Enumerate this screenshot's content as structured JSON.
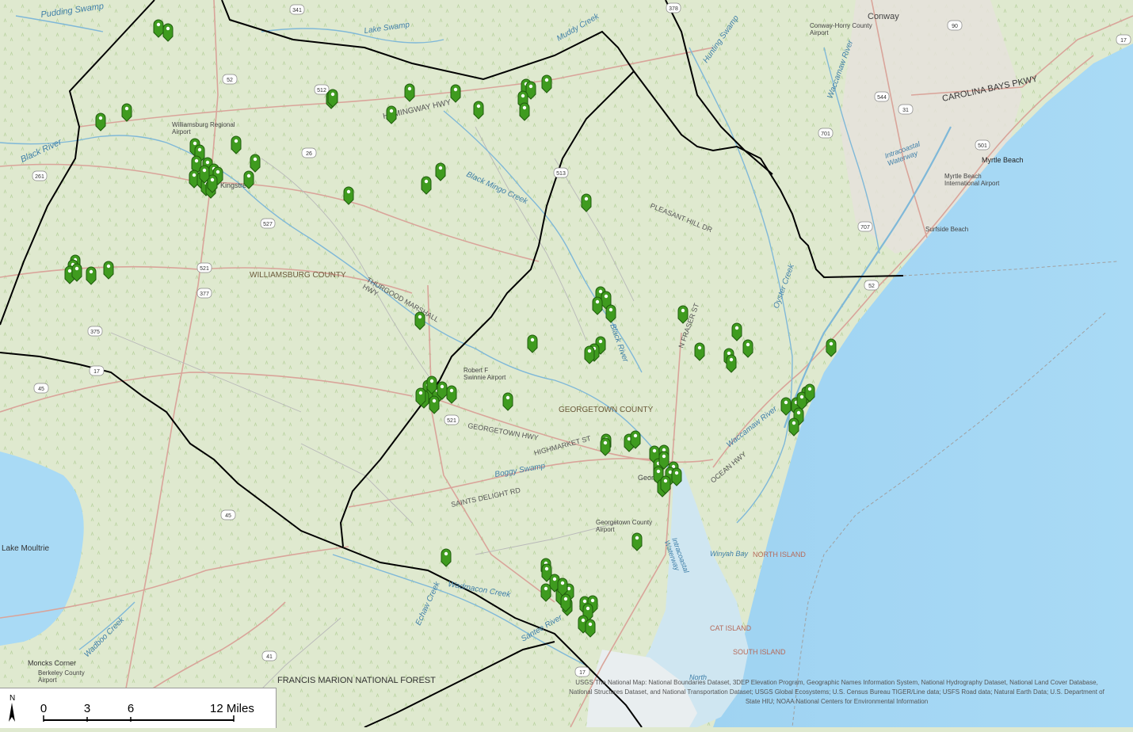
{
  "map": {
    "place_labels": [
      {
        "id": "pudding-swamp",
        "text": "Pudding Swamp"
      },
      {
        "id": "lake-swamp",
        "text": "Lake Swamp"
      },
      {
        "id": "muddy-creek",
        "text": "Muddy Creek"
      },
      {
        "id": "conway",
        "text": "Conway"
      },
      {
        "id": "conway-airport",
        "text": "Conway-Horry County Airport"
      },
      {
        "id": "hunting-swamp",
        "text": "Hunting Swamp"
      },
      {
        "id": "waccamaw-river-n",
        "text": "Waccamaw River"
      },
      {
        "id": "carolina-bays",
        "text": "CAROLINA BAYS PKWY"
      },
      {
        "id": "williamsburg-airport",
        "text": "Williamsburg Regional Airport"
      },
      {
        "id": "hemingway-hwy",
        "text": "HEMINGWAY HWY"
      },
      {
        "id": "black-river",
        "text": "Black River"
      },
      {
        "id": "kingstree",
        "text": "Kingstree"
      },
      {
        "id": "black-mingo",
        "text": "Black Mingo Creek"
      },
      {
        "id": "pleasant-hill",
        "text": "PLEASANT HILL DR"
      },
      {
        "id": "intracoastal-n",
        "text": "Intracoastal Waterway"
      },
      {
        "id": "myrtle-beach",
        "text": "Myrtle Beach"
      },
      {
        "id": "mb-airport",
        "text": "Myrtle Beach International Airport"
      },
      {
        "id": "surfside",
        "text": "Surfside Beach"
      },
      {
        "id": "williamsburg-county",
        "text": "WILLIAMSBURG COUNTY"
      },
      {
        "id": "thurgood",
        "text": "THURGOOD MARSHALL HWY"
      },
      {
        "id": "fraser-st",
        "text": "N FRASER ST"
      },
      {
        "id": "oyster-creek",
        "text": "Oyster Creek"
      },
      {
        "id": "black-river-2",
        "text": "Black River"
      },
      {
        "id": "swinnie-airport",
        "text": "Robert F Swinnie Airport"
      },
      {
        "id": "georgetown-county",
        "text": "GEORGETOWN COUNTY"
      },
      {
        "id": "georgetown-hwy",
        "text": "GEORGETOWN HWY"
      },
      {
        "id": "highmarket",
        "text": "HIGHMARKET ST"
      },
      {
        "id": "boggy-swamp",
        "text": "Boggy Swamp"
      },
      {
        "id": "saints-delight",
        "text": "SAINTS DELIGHT RD"
      },
      {
        "id": "waccamaw-river-s",
        "text": "Waccamaw River"
      },
      {
        "id": "ocean-hwy",
        "text": "OCEAN HWY"
      },
      {
        "id": "georgetown",
        "text": "Georgetown"
      },
      {
        "id": "georgetown-airport",
        "text": "Georgetown County Airport"
      },
      {
        "id": "lake-moultrie",
        "text": "Lake Moultrie"
      },
      {
        "id": "intracoastal-s",
        "text": "Intracoastal Waterway"
      },
      {
        "id": "winyah-bay",
        "text": "Winyah Bay"
      },
      {
        "id": "north-island",
        "text": "NORTH ISLAND"
      },
      {
        "id": "wadmacon",
        "text": "Wadmacon Creek"
      },
      {
        "id": "echaw",
        "text": "Echaw Creek"
      },
      {
        "id": "wadboo",
        "text": "Wadboo Creek"
      },
      {
        "id": "cat-island",
        "text": "CAT ISLAND"
      },
      {
        "id": "south-island",
        "text": "SOUTH ISLAND"
      },
      {
        "id": "moncks-corner",
        "text": "Moncks Corner"
      },
      {
        "id": "berkeley-airport",
        "text": "Berkeley County Airport"
      },
      {
        "id": "francis-marion",
        "text": "FRANCIS MARION NATIONAL FOREST"
      },
      {
        "id": "north-label",
        "text": "North"
      },
      {
        "id": "santee",
        "text": "Santee River"
      }
    ],
    "route_shields": [
      "341",
      "378",
      "90",
      "17",
      "52",
      "512",
      "544",
      "31",
      "501",
      "261",
      "26",
      "513",
      "701",
      "707",
      "527",
      "521",
      "377",
      "375",
      "17",
      "52",
      "45",
      "521",
      "45",
      "41",
      "17"
    ],
    "marker_color": "#3f9b1f",
    "marker_outline": "#1f5c0c",
    "marker_count": 140
  },
  "scale_bar": {
    "ticks": [
      "0",
      "3",
      "6",
      "12 Miles"
    ],
    "north_symbol": "N"
  },
  "attribution": "USGS The National Map: National Boundaries Dataset, 3DEP Elevation Program, Geographic Names Information System, National Hydrography Dataset, National Land Cover Database, National Structures Dataset, and National Transportation Dataset; USGS Global Ecosystems; U.S. Census Bureau TIGER/Line data; USFS Road data; Natural Earth Data; U.S. Department of State HIU; NOAA National Centers for Environmental Information"
}
